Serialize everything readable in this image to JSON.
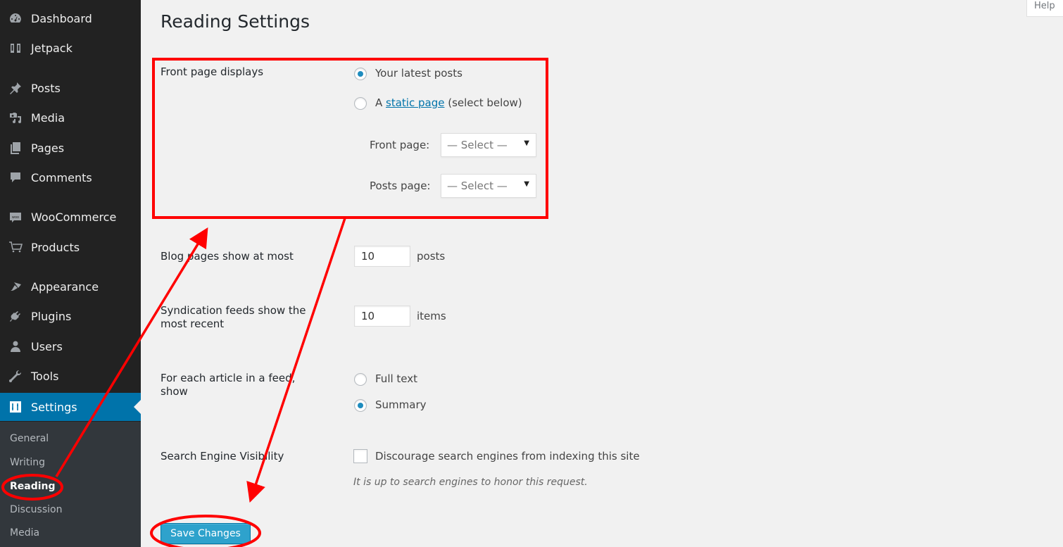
{
  "sidebar": {
    "items": [
      {
        "label": "Dashboard",
        "icon": "dashboard-icon"
      },
      {
        "label": "Jetpack",
        "icon": "jetpack-icon"
      },
      {
        "label": "Posts",
        "icon": "pin-icon"
      },
      {
        "label": "Media",
        "icon": "media-icon"
      },
      {
        "label": "Pages",
        "icon": "pages-icon"
      },
      {
        "label": "Comments",
        "icon": "comment-icon"
      },
      {
        "label": "WooCommerce",
        "icon": "woocommerce-icon"
      },
      {
        "label": "Products",
        "icon": "cart-icon"
      },
      {
        "label": "Appearance",
        "icon": "brush-icon"
      },
      {
        "label": "Plugins",
        "icon": "plug-icon"
      },
      {
        "label": "Users",
        "icon": "user-icon"
      },
      {
        "label": "Tools",
        "icon": "wrench-icon"
      },
      {
        "label": "Settings",
        "icon": "settings-icon",
        "active": true
      }
    ],
    "submenu": [
      {
        "label": "General"
      },
      {
        "label": "Writing"
      },
      {
        "label": "Reading",
        "current": true
      },
      {
        "label": "Discussion"
      },
      {
        "label": "Media"
      }
    ]
  },
  "header": {
    "help_label": "Help",
    "title": "Reading Settings"
  },
  "form": {
    "front_page": {
      "label": "Front page displays",
      "options": [
        {
          "label": "Your latest posts",
          "checked": true
        },
        {
          "prefix": "A ",
          "link": "static page",
          "suffix": " (select below)",
          "checked": false
        }
      ],
      "front_page_label": "Front page:",
      "front_page_value": "— Select —",
      "posts_page_label": "Posts page:",
      "posts_page_value": "— Select —"
    },
    "blog_pages": {
      "label": "Blog pages show at most",
      "value": "10",
      "unit": "posts"
    },
    "syndication": {
      "label_line1": "Syndication feeds show the",
      "label_line2": "most recent",
      "value": "10",
      "unit": "items"
    },
    "feed_article": {
      "label_line1": "For each article in a feed,",
      "label_line2": "show",
      "options": [
        {
          "label": "Full text",
          "checked": false
        },
        {
          "label": "Summary",
          "checked": true
        }
      ]
    },
    "search_visibility": {
      "label": "Search Engine Visibility",
      "checkbox_label": "Discourage search engines from indexing this site",
      "checked": false,
      "hint": "It is up to search engines to honor this request."
    },
    "save_label": "Save Changes"
  },
  "colors": {
    "sidebar_bg": "#222222",
    "submenu_bg": "#32373c",
    "active_bg": "#0073aa",
    "button_bg": "#2ea2cc",
    "annotation": "#ff0000"
  }
}
